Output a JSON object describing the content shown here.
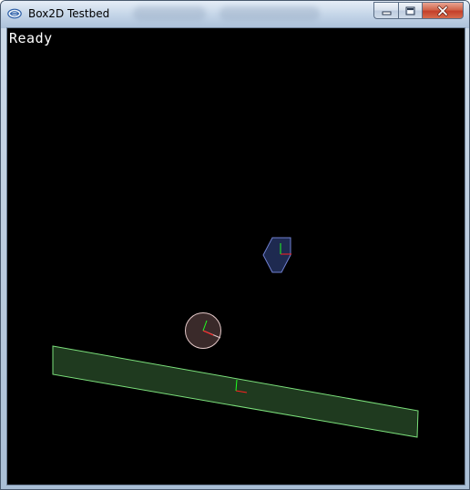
{
  "window": {
    "title": "Box2D Testbed",
    "app_icon": "window-app-icon",
    "buttons": {
      "minimize": "minimize-icon",
      "maximize": "maximize-icon",
      "close": "close-icon"
    }
  },
  "canvas": {
    "status_text": "Ready",
    "background_color": "#000000"
  },
  "scene": {
    "bodies": [
      {
        "kind": "hexagon",
        "fill": "#1e2a50",
        "outline": "#6f7fd0"
      },
      {
        "kind": "circle",
        "fill": "#3a2a2a",
        "outline": "#e3c7c7"
      },
      {
        "kind": "ground-plank",
        "fill": "#1f3a1f",
        "outline": "#7be07b"
      }
    ],
    "axis_colors": {
      "x": "#ff2020",
      "y": "#20ff20"
    }
  }
}
